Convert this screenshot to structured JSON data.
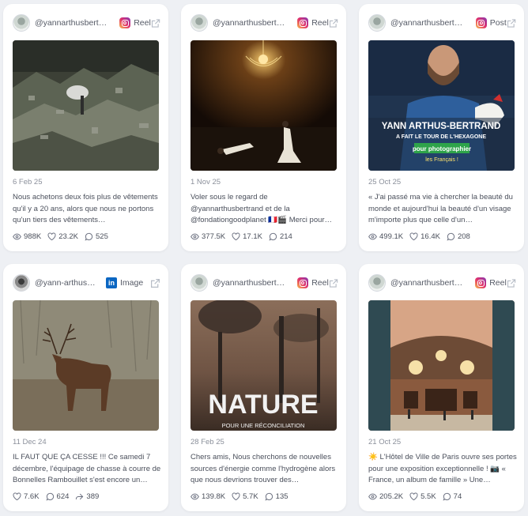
{
  "posts": [
    {
      "handle": "@yannarthusbert…",
      "platform_icon": "instagram-icon",
      "type": "Reel",
      "date": "6 Feb 25",
      "caption": "Nous achetons deux fois plus de vêtements qu'il y a 20 ans, alors que nous ne portons qu'un tiers des vêtements…",
      "stats": {
        "views": "988K",
        "likes": "23.2K",
        "comments": "525"
      }
    },
    {
      "handle": "@yannarthusbert…",
      "platform_icon": "instagram-icon",
      "type": "Reel",
      "date": "1 Nov 25",
      "caption": "Voler sous le regard de @yannarthusbertrand et de la @fondationgoodplanet 🇫🇷🎬 Merci pour…",
      "stats": {
        "views": "377.5K",
        "likes": "17.1K",
        "comments": "214"
      }
    },
    {
      "handle": "@yannarthusbert…",
      "platform_icon": "instagram-icon",
      "type": "Post",
      "date": "25 Oct 25",
      "caption": "« J'ai passé ma vie à chercher la beauté du monde et aujourd'hui la beauté d'un visage m'importe plus que celle d'un…",
      "stats": {
        "views": "499.1K",
        "likes": "16.4K",
        "comments": "208"
      },
      "overlay": {
        "name": "YANN ARTHUS-BERTRAND",
        "line2": "A FAIT LE TOUR DE L'HEXAGONE",
        "highlight": "pour photographier",
        "line4": "les Français !"
      }
    },
    {
      "handle": "@yann-arthus…",
      "platform_icon": "linkedin-icon",
      "type": "Image",
      "date": "11 Dec 24",
      "caption": "IL FAUT QUE ÇA CESSE !!! Ce samedi 7 décembre, l'équipage de chasse à courre de Bonnelles Rambouillet s'est encore un…",
      "stats": {
        "likes": "7.6K",
        "comments": "624",
        "shares": "389"
      }
    },
    {
      "handle": "@yannarthusbert…",
      "platform_icon": "instagram-icon",
      "type": "Reel",
      "date": "28 Feb 25",
      "caption": "Chers amis, Nous cherchons de nouvelles sources d'énergie comme l'hydrogène alors que nous devrions trouver des…",
      "stats": {
        "views": "139.8K",
        "likes": "5.7K",
        "comments": "135"
      },
      "overlay": {
        "title": "NATURE",
        "subtitle": "POUR UNE RÉCONCILIATION"
      }
    },
    {
      "handle": "@yannarthusbert…",
      "platform_icon": "instagram-icon",
      "type": "Reel",
      "date": "21 Oct 25",
      "caption": "☀️ L'Hôtel de Ville de Paris ouvre ses portes pour une exposition exceptionnelle ! 📷 « France, un album de famille » Une…",
      "stats": {
        "views": "205.2K",
        "likes": "5.5K",
        "comments": "74"
      }
    }
  ]
}
